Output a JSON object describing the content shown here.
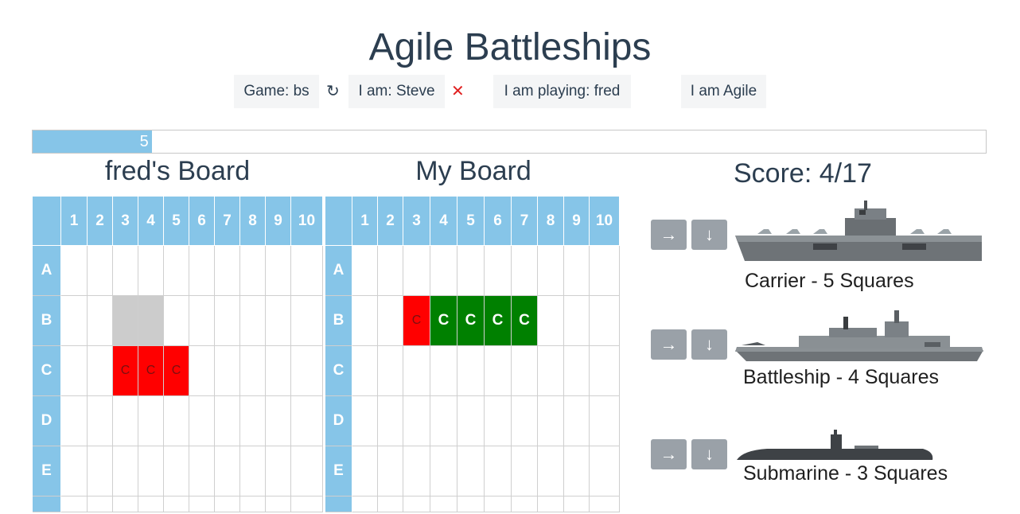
{
  "title": "Agile Battleships",
  "header": {
    "game": "Game: bs",
    "refresh_glyph": "↻",
    "user": "I am: Steve",
    "close_glyph": "✕",
    "opponent": "I am playing: fred",
    "mode": "I am Agile"
  },
  "progress": {
    "value": 5,
    "fraction": 0.125,
    "label": "5"
  },
  "opponent_board": {
    "title": "fred's Board",
    "columns": [
      "1",
      "2",
      "3",
      "4",
      "5",
      "6",
      "7",
      "8",
      "9",
      "10"
    ],
    "rows": [
      "A",
      "B",
      "C",
      "D",
      "E"
    ],
    "cells": [
      [
        "",
        "",
        "",
        "",
        "",
        "",
        "",
        "",
        "",
        ""
      ],
      [
        "",
        "",
        "",
        "",
        "",
        "",
        "",
        "",
        "",
        ""
      ],
      [
        "",
        "",
        "C",
        "C",
        "C",
        "",
        "",
        "",
        "",
        ""
      ],
      [
        "",
        "",
        "",
        "",
        "",
        "",
        "",
        "",
        "",
        ""
      ],
      [
        "",
        "",
        "",
        "",
        "",
        "",
        "",
        "",
        "",
        ""
      ]
    ],
    "states": [
      [
        "",
        "",
        "",
        "",
        "",
        "",
        "",
        "",
        "",
        ""
      ],
      [
        "",
        "",
        "miss",
        "miss",
        "",
        "",
        "",
        "",
        "",
        ""
      ],
      [
        "",
        "",
        "hit",
        "hit",
        "hit",
        "",
        "",
        "",
        "",
        ""
      ],
      [
        "",
        "",
        "",
        "",
        "",
        "",
        "",
        "",
        "",
        ""
      ],
      [
        "",
        "",
        "",
        "",
        "",
        "",
        "",
        "",
        "",
        ""
      ]
    ]
  },
  "my_board": {
    "title": "My Board",
    "columns": [
      "1",
      "2",
      "3",
      "4",
      "5",
      "6",
      "7",
      "8",
      "9",
      "10"
    ],
    "rows": [
      "A",
      "B",
      "C",
      "D",
      "E"
    ],
    "cells": [
      [
        "",
        "",
        "",
        "",
        "",
        "",
        "",
        "",
        "",
        ""
      ],
      [
        "",
        "",
        "C",
        "C",
        "C",
        "C",
        "C",
        "",
        "",
        ""
      ],
      [
        "",
        "",
        "",
        "",
        "",
        "",
        "",
        "",
        "",
        ""
      ],
      [
        "",
        "",
        "",
        "",
        "",
        "",
        "",
        "",
        "",
        ""
      ],
      [
        "",
        "",
        "",
        "",
        "",
        "",
        "",
        "",
        "",
        ""
      ]
    ],
    "states": [
      [
        "",
        "",
        "",
        "",
        "",
        "",
        "",
        "",
        "",
        ""
      ],
      [
        "",
        "",
        "hit",
        "ship",
        "ship",
        "ship",
        "ship",
        "",
        "",
        ""
      ],
      [
        "",
        "",
        "",
        "",
        "",
        "",
        "",
        "",
        "",
        ""
      ],
      [
        "",
        "",
        "",
        "",
        "",
        "",
        "",
        "",
        "",
        ""
      ],
      [
        "",
        "",
        "",
        "",
        "",
        "",
        "",
        "",
        "",
        ""
      ]
    ]
  },
  "score": "Score: 4/17",
  "ships": [
    {
      "caption": "Carrier - 5 Squares",
      "horizontal": "→",
      "vertical": "↓"
    },
    {
      "caption": "Battleship - 4 Squares",
      "horizontal": "→",
      "vertical": "↓"
    },
    {
      "caption": "Submarine - 3 Squares",
      "horizontal": "→",
      "vertical": "↓"
    }
  ],
  "colors": {
    "header_blue": "#86c5e8",
    "hit_red": "#ff0000",
    "ship_green": "#008000",
    "miss_grey": "#cccccc",
    "button_grey": "#9aa1a8"
  }
}
